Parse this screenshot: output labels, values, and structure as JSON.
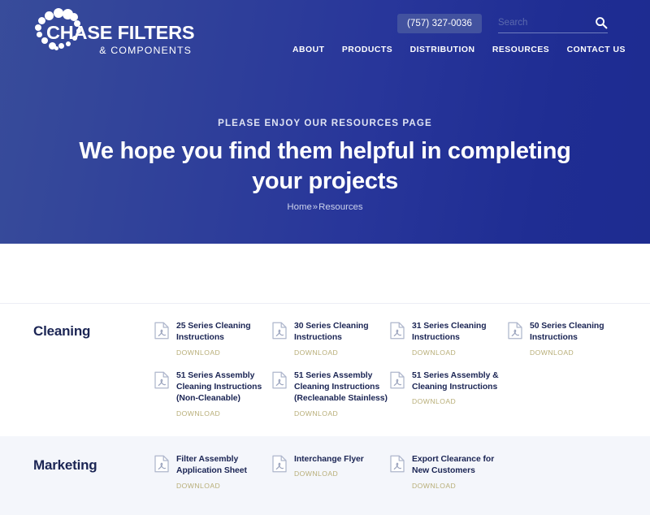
{
  "site": {
    "logo_main": "CHASE FILTERS",
    "logo_sub": "& COMPONENTS"
  },
  "header": {
    "phone": "(757) 327-0036",
    "search_placeholder": "Search",
    "search_value": "",
    "nav": [
      {
        "label": "ABOUT"
      },
      {
        "label": "PRODUCTS"
      },
      {
        "label": "DISTRIBUTION"
      },
      {
        "label": "RESOURCES"
      },
      {
        "label": "CONTACT US"
      }
    ]
  },
  "hero": {
    "eyebrow": "PLEASE ENJOY OUR RESOURCES PAGE",
    "title": "We hope you find them helpful in completing your projects",
    "breadcrumb_home": "Home",
    "breadcrumb_sep": "»",
    "breadcrumb_current": "Resources"
  },
  "download_label": "DOWNLOAD",
  "sections": [
    {
      "title": "Cleaning",
      "items": [
        {
          "title": "25 Series Cleaning Instructions",
          "download": "DOWNLOAD"
        },
        {
          "title": "30 Series Cleaning Instructions",
          "download": "DOWNLOAD"
        },
        {
          "title": "31 Series Cleaning Instructions",
          "download": "DOWNLOAD"
        },
        {
          "title": "50 Series Cleaning Instructions",
          "download": "DOWNLOAD"
        },
        {
          "title": "51 Series Assembly Cleaning Instructions (Non-Cleanable)",
          "download": "DOWNLOAD"
        },
        {
          "title": "51 Series Assembly Cleaning Instructions (Recleanable Stainless)",
          "download": "DOWNLOAD"
        },
        {
          "title": "51 Series Assembly & Cleaning Instructions",
          "download": "DOWNLOAD"
        }
      ]
    },
    {
      "title": "Marketing",
      "items": [
        {
          "title": "Filter Assembly Application Sheet",
          "download": "DOWNLOAD"
        },
        {
          "title": "Interchange Flyer",
          "download": "DOWNLOAD"
        },
        {
          "title": "Export Clearance for New Customers",
          "download": "DOWNLOAD"
        }
      ]
    }
  ],
  "colors": {
    "brand_blue": "#283a9a",
    "brand_blue_light": "#3a4f9b",
    "navy_text": "#1b2554",
    "download_gold": "#b8ae78",
    "alt_section_bg": "#f4f6fb"
  }
}
